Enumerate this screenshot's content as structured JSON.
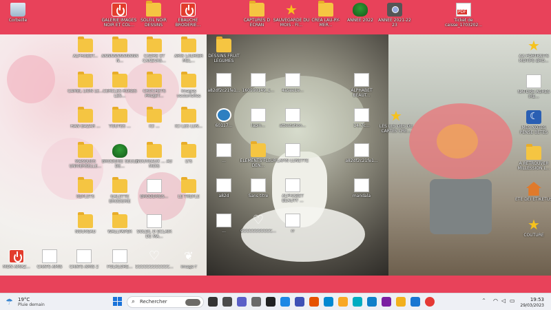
{
  "desktop": {
    "top_icons": [
      {
        "label": "Corbeille",
        "icon": "recycle-bin-icon"
      },
      {
        "label": "GALERIE IMAGES NOIR ET COL...",
        "icon": "power-app-icon"
      },
      {
        "label": "SOLEIL NOIR DESSINS",
        "icon": "folder-icon"
      },
      {
        "label": "EBAUCHE BRODERIE...",
        "icon": "power-app-icon"
      },
      {
        "label": "CAPTURES D ECRAN",
        "icon": "folder-icon"
      },
      {
        "label": "SAUVEGARDE DU MOIS - FI...",
        "icon": "star-icon"
      },
      {
        "label": "CREA LAU-RY-MER...",
        "icon": "folder-icon"
      },
      {
        "label": "ANNEE 2022",
        "icon": "tree-icon"
      },
      {
        "label": "ANNEE 2021-22 23",
        "icon": "camera-icon"
      },
      {
        "label": "Ticket de caisse_1703202...",
        "icon": "pdf-icon"
      }
    ],
    "left_icons": [
      {
        "label": "ALPHABET...",
        "icon": "folder-icon"
      },
      {
        "label": "ANNNNNNNNNNNN...",
        "icon": "folder-icon"
      },
      {
        "label": "CADRE ET CANEVAS...",
        "icon": "folder-icon"
      },
      {
        "label": "ARIS LAURIER MEL...",
        "icon": "folder-icon"
      },
      {
        "label": "CAMEL LION LE...",
        "icon": "folder-icon"
      },
      {
        "label": "CERCLES ROSES LES...",
        "icon": "folder-icon"
      },
      {
        "label": "CROCHETS PROJET...",
        "icon": "folder-icon"
      },
      {
        "label": "images vectorielles",
        "icon": "folder-icon"
      },
      {
        "label": "HAN BAZAR ...",
        "icon": "folder-icon"
      },
      {
        "label": "TOUTES ...",
        "icon": "folder-icon"
      },
      {
        "label": "ICI ...",
        "icon": "folder-icon"
      },
      {
        "label": "ICI LES LUN...",
        "icon": "folder-icon"
      },
      {
        "label": "MASQUES UNIVERSELLE...",
        "icon": "folder-icon"
      },
      {
        "label": "BRODERIE SEULE DE...",
        "icon": "tree-icon"
      },
      {
        "label": "NOUVEAUX ... AU MOIS",
        "icon": "folder-icon"
      },
      {
        "label": "LYS",
        "icon": "folder-icon"
      },
      {
        "label": "REFLETS",
        "icon": "folder-icon"
      },
      {
        "label": "GALETTE BRODERIE",
        "icon": "folder-icon"
      },
      {
        "label": "BRODERIES...",
        "icon": "sheet-icon"
      },
      {
        "label": "LE TREFLE",
        "icon": "folder-icon"
      },
      {
        "label": "NOUVEAU",
        "icon": "folder-icon"
      },
      {
        "label": "WALLPAPER",
        "icon": "folder-icon"
      },
      {
        "label": "SOLEIL D ECLAIR DE MA...",
        "icon": "sheet-icon"
      },
      {
        "label": "MON AMAZ...",
        "icon": "power-app-icon"
      },
      {
        "label": "CHATS AMIS",
        "icon": "sheet-icon"
      },
      {
        "label": "CHATS AMIS 2",
        "icon": "sheet-icon"
      },
      {
        "label": "FOLKLORE...",
        "icon": "sheet-icon"
      },
      {
        "label": "CCCCCCCCCCCC...",
        "icon": "heart-icon"
      },
      {
        "label": "image f",
        "icon": "leaf-icon"
      }
    ],
    "mid_icons": [
      {
        "label": "DESSINS FRUIT LEGUMES",
        "icon": "folder-icon"
      },
      {
        "label": "a82df2c21fe1...",
        "icon": "sheet-icon"
      },
      {
        "label": "160590149_1...",
        "icon": "sheet-icon"
      },
      {
        "label": "4a5ee1e...",
        "icon": "sheet-icon"
      },
      {
        "label": "ALPHABET BEAUT...",
        "icon": "sheet-icon"
      },
      {
        "label": "60117...",
        "icon": "circle-icon"
      },
      {
        "label": "lapin...",
        "icon": "sheet-icon"
      },
      {
        "label": "attestation...",
        "icon": "sheet-icon"
      },
      {
        "label": "14_7c...",
        "icon": "sheet-icon"
      },
      {
        "label": "...",
        "icon": "sheet-icon"
      },
      {
        "label": "ELEMENTS FLEUR DEN...",
        "icon": "folder-icon"
      },
      {
        "label": "LAPIN LUNETTE",
        "icon": "sheet-icon"
      },
      {
        "label": "a82df2c21fe1...",
        "icon": "sheet-icon"
      },
      {
        "label": "a82d",
        "icon": "sheet-icon"
      },
      {
        "label": "Sans titre",
        "icon": "sheet-icon"
      },
      {
        "label": "ALPHABET BEAUTY ...",
        "icon": "sheet-icon"
      },
      {
        "label": "mandala",
        "icon": "sheet-icon"
      },
      {
        "label": "...",
        "icon": "sheet-icon"
      },
      {
        "label": "CCCCCCCCCCC...",
        "icon": "heart-icon"
      },
      {
        "label": "rr",
        "icon": "sheet-icon"
      }
    ],
    "right_icons": [
      {
        "label": "AA PORTRAITS MOTIFS BRO...",
        "icon": "star-icon"
      },
      {
        "label": "NATURE AGRES IRE...",
        "icon": "sheet-icon"
      },
      {
        "label": "MES NOTES PENSE BETES",
        "icon": "moon-icon"
      },
      {
        "label": "A RETROUVER MILLESSION L...",
        "icon": "folder-icon"
      },
      {
        "label": "ETE DEI ETIKETUS",
        "icon": "house-icon"
      },
      {
        "label": "COUTURE",
        "icon": "star-icon"
      }
    ],
    "floating_star": {
      "label": "LES LES DES DE CARTES CRE...",
      "icon": "star-icon"
    }
  },
  "taskbar": {
    "weather_temp": "19°C",
    "weather_desc": "Pluie demain",
    "search_placeholder": "Rechercher",
    "clock_time": "19:53",
    "clock_date": "29/03/2023",
    "tray_chevron": "^",
    "apps": [
      "task-view-icon",
      "file-manager-icon",
      "teams-icon",
      "settings-icon",
      "media-player-icon",
      "photos-icon",
      "paint-icon",
      "office-icon",
      "calendar-icon",
      "notes-icon",
      "snip-icon",
      "edge-icon",
      "paint-3d-icon",
      "explorer-icon",
      "store-icon",
      "chrome-icon"
    ]
  }
}
